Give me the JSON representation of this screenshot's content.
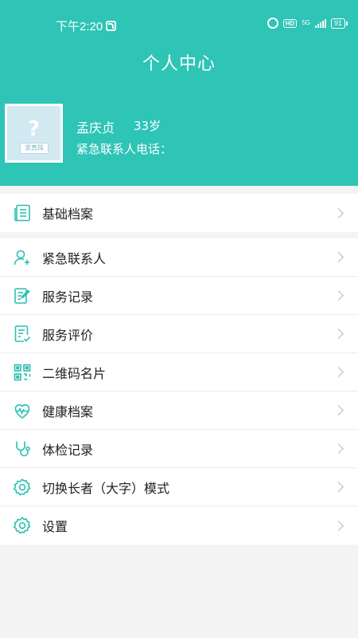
{
  "status_bar": {
    "time": "下午2:20",
    "network": "5G",
    "hd": "HD",
    "battery": "91"
  },
  "header": {
    "title": "个人中心"
  },
  "profile": {
    "name": "孟庆贞",
    "age": "33岁",
    "emergency_label": "紧急联系人电话：",
    "avatar_sign_text": "求真珠"
  },
  "menu": {
    "basic_records": "基础档案",
    "items": [
      {
        "label": "紧急联系人",
        "icon": "person-add-icon"
      },
      {
        "label": "服务记录",
        "icon": "edit-document-icon"
      },
      {
        "label": "服务评价",
        "icon": "checklist-icon"
      },
      {
        "label": "二维码名片",
        "icon": "qr-code-icon"
      },
      {
        "label": "健康档案",
        "icon": "heartbeat-icon"
      },
      {
        "label": "体检记录",
        "icon": "stethoscope-icon"
      },
      {
        "label": "切换长者（大字）模式",
        "icon": "settings-gear-icon"
      },
      {
        "label": "设置",
        "icon": "gear-icon"
      }
    ]
  },
  "colors": {
    "accent": "#2ec4b6",
    "icon": "#2bbfb3",
    "background": "#f4f4f4"
  }
}
